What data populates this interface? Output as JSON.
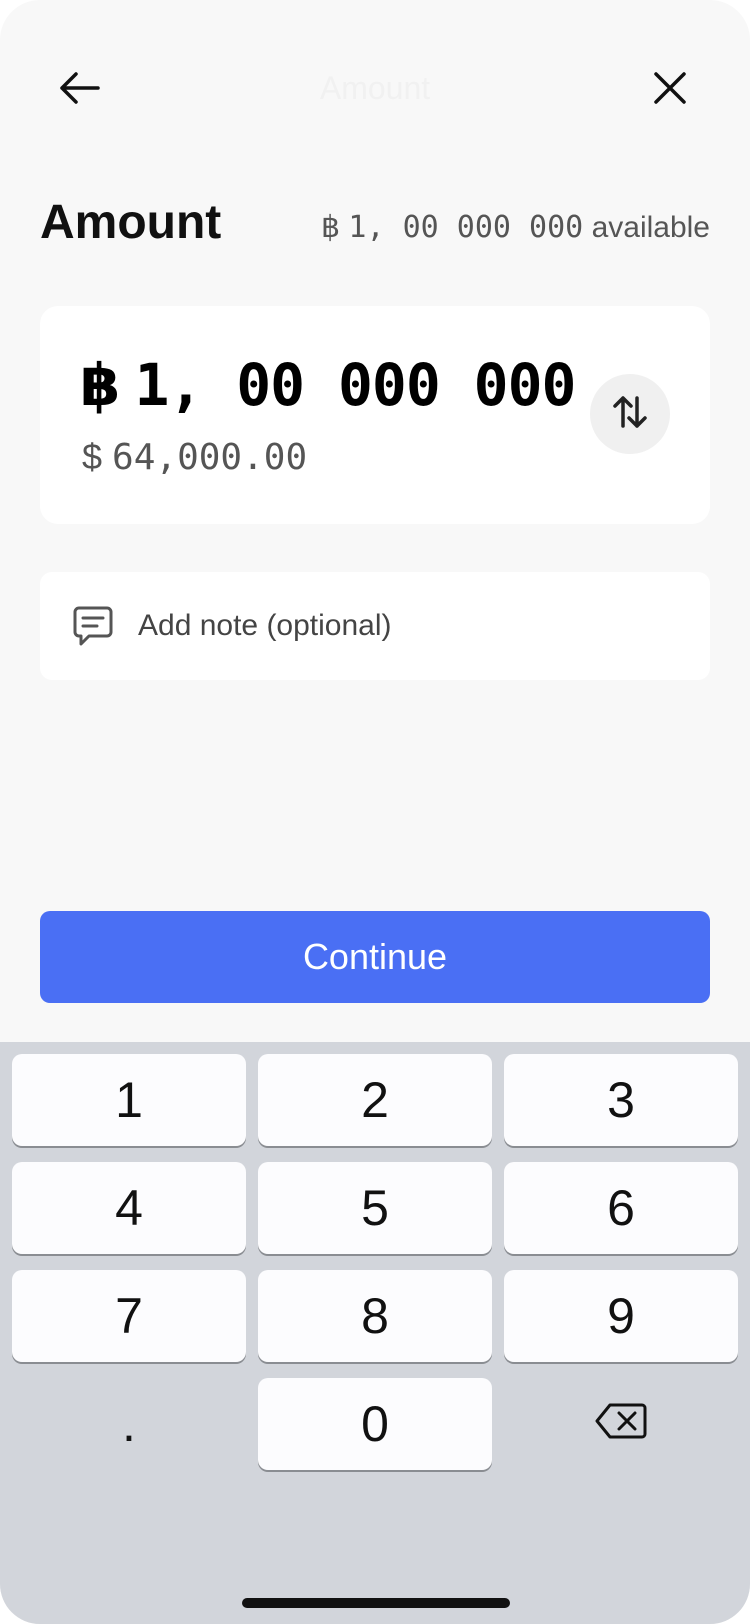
{
  "nav": {
    "title": "Amount",
    "back_icon": "arrow-left-icon",
    "close_icon": "close-icon"
  },
  "header": {
    "title": "Amount",
    "available_symbol": "฿",
    "available_amount": "1, 00 000 000",
    "available_suffix": "available"
  },
  "amount_card": {
    "primary_symbol": "฿",
    "primary_amount": "1, 00 000 000",
    "secondary_symbol": "$",
    "secondary_amount": "64,000.00",
    "swap_icon": "swap-vertical-icon"
  },
  "note": {
    "icon": "message-square-icon",
    "label": "Add note (optional)"
  },
  "continue_button": {
    "label": "Continue",
    "color": "#4a6ff4"
  },
  "keypad": {
    "keys": [
      "1",
      "2",
      "3",
      "4",
      "5",
      "6",
      "7",
      "8",
      "9",
      ".",
      "0"
    ],
    "backspace_icon": "backspace-icon"
  }
}
